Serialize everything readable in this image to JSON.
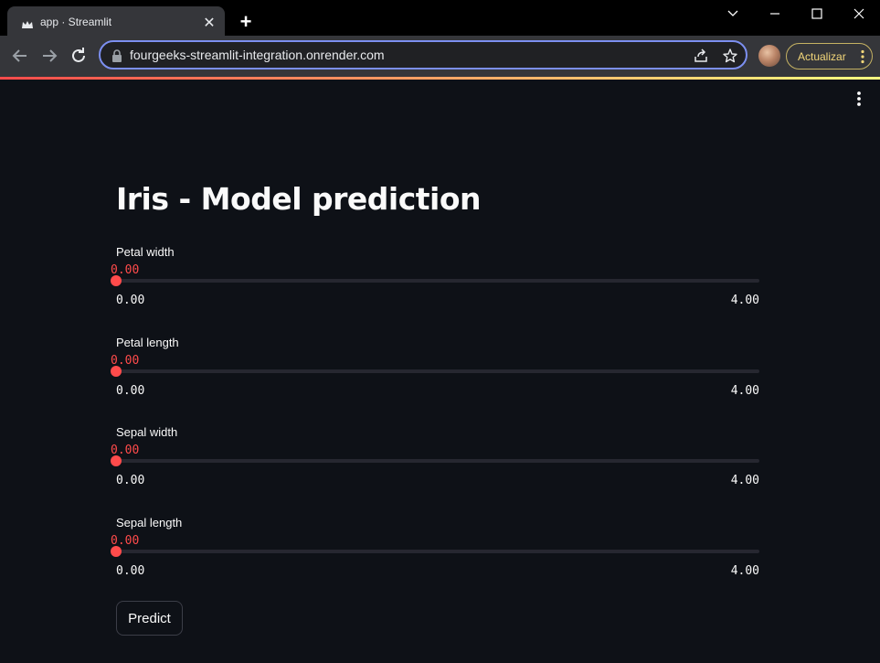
{
  "browser": {
    "tab_title": "app · Streamlit",
    "url": "fourgeeks-streamlit-integration.onrender.com",
    "update_label": "Actualizar"
  },
  "app": {
    "title": "Iris - Model prediction",
    "sliders": [
      {
        "label": "Petal width",
        "value": "0.00",
        "min": "0.00",
        "max": "4.00",
        "fraction": 0
      },
      {
        "label": "Petal length",
        "value": "0.00",
        "min": "0.00",
        "max": "4.00",
        "fraction": 0
      },
      {
        "label": "Sepal width",
        "value": "0.00",
        "min": "0.00",
        "max": "4.00",
        "fraction": 0
      },
      {
        "label": "Sepal length",
        "value": "0.00",
        "min": "0.00",
        "max": "4.00",
        "fraction": 0
      }
    ],
    "predict_label": "Predict"
  },
  "colors": {
    "accent": "#ff4b4b",
    "background": "#0e1117",
    "text": "#fafafa"
  }
}
